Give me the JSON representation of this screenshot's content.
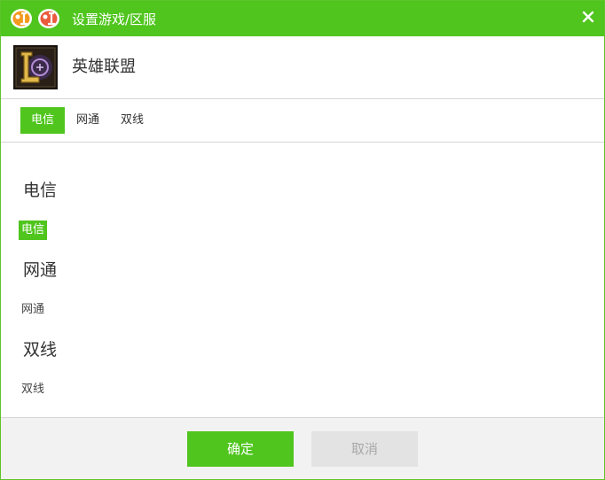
{
  "window": {
    "title": "设置游戏/区服",
    "logo_icon": "dada-logo-icon",
    "close_icon": "close-icon",
    "accent_color": "#4fc51d"
  },
  "game": {
    "name": "英雄联盟",
    "icon": "league-of-legends-icon"
  },
  "tabs": [
    {
      "label": "电信",
      "active": true
    },
    {
      "label": "网通",
      "active": false
    },
    {
      "label": "双线",
      "active": false
    }
  ],
  "groups": [
    {
      "title": "电信",
      "servers": [
        {
          "label": "电信",
          "selected": true
        }
      ]
    },
    {
      "title": "网通",
      "servers": [
        {
          "label": "网通",
          "selected": false
        }
      ]
    },
    {
      "title": "双线",
      "servers": [
        {
          "label": "双线",
          "selected": false
        }
      ]
    }
  ],
  "footer": {
    "ok_label": "确定",
    "cancel_label": "取消"
  }
}
